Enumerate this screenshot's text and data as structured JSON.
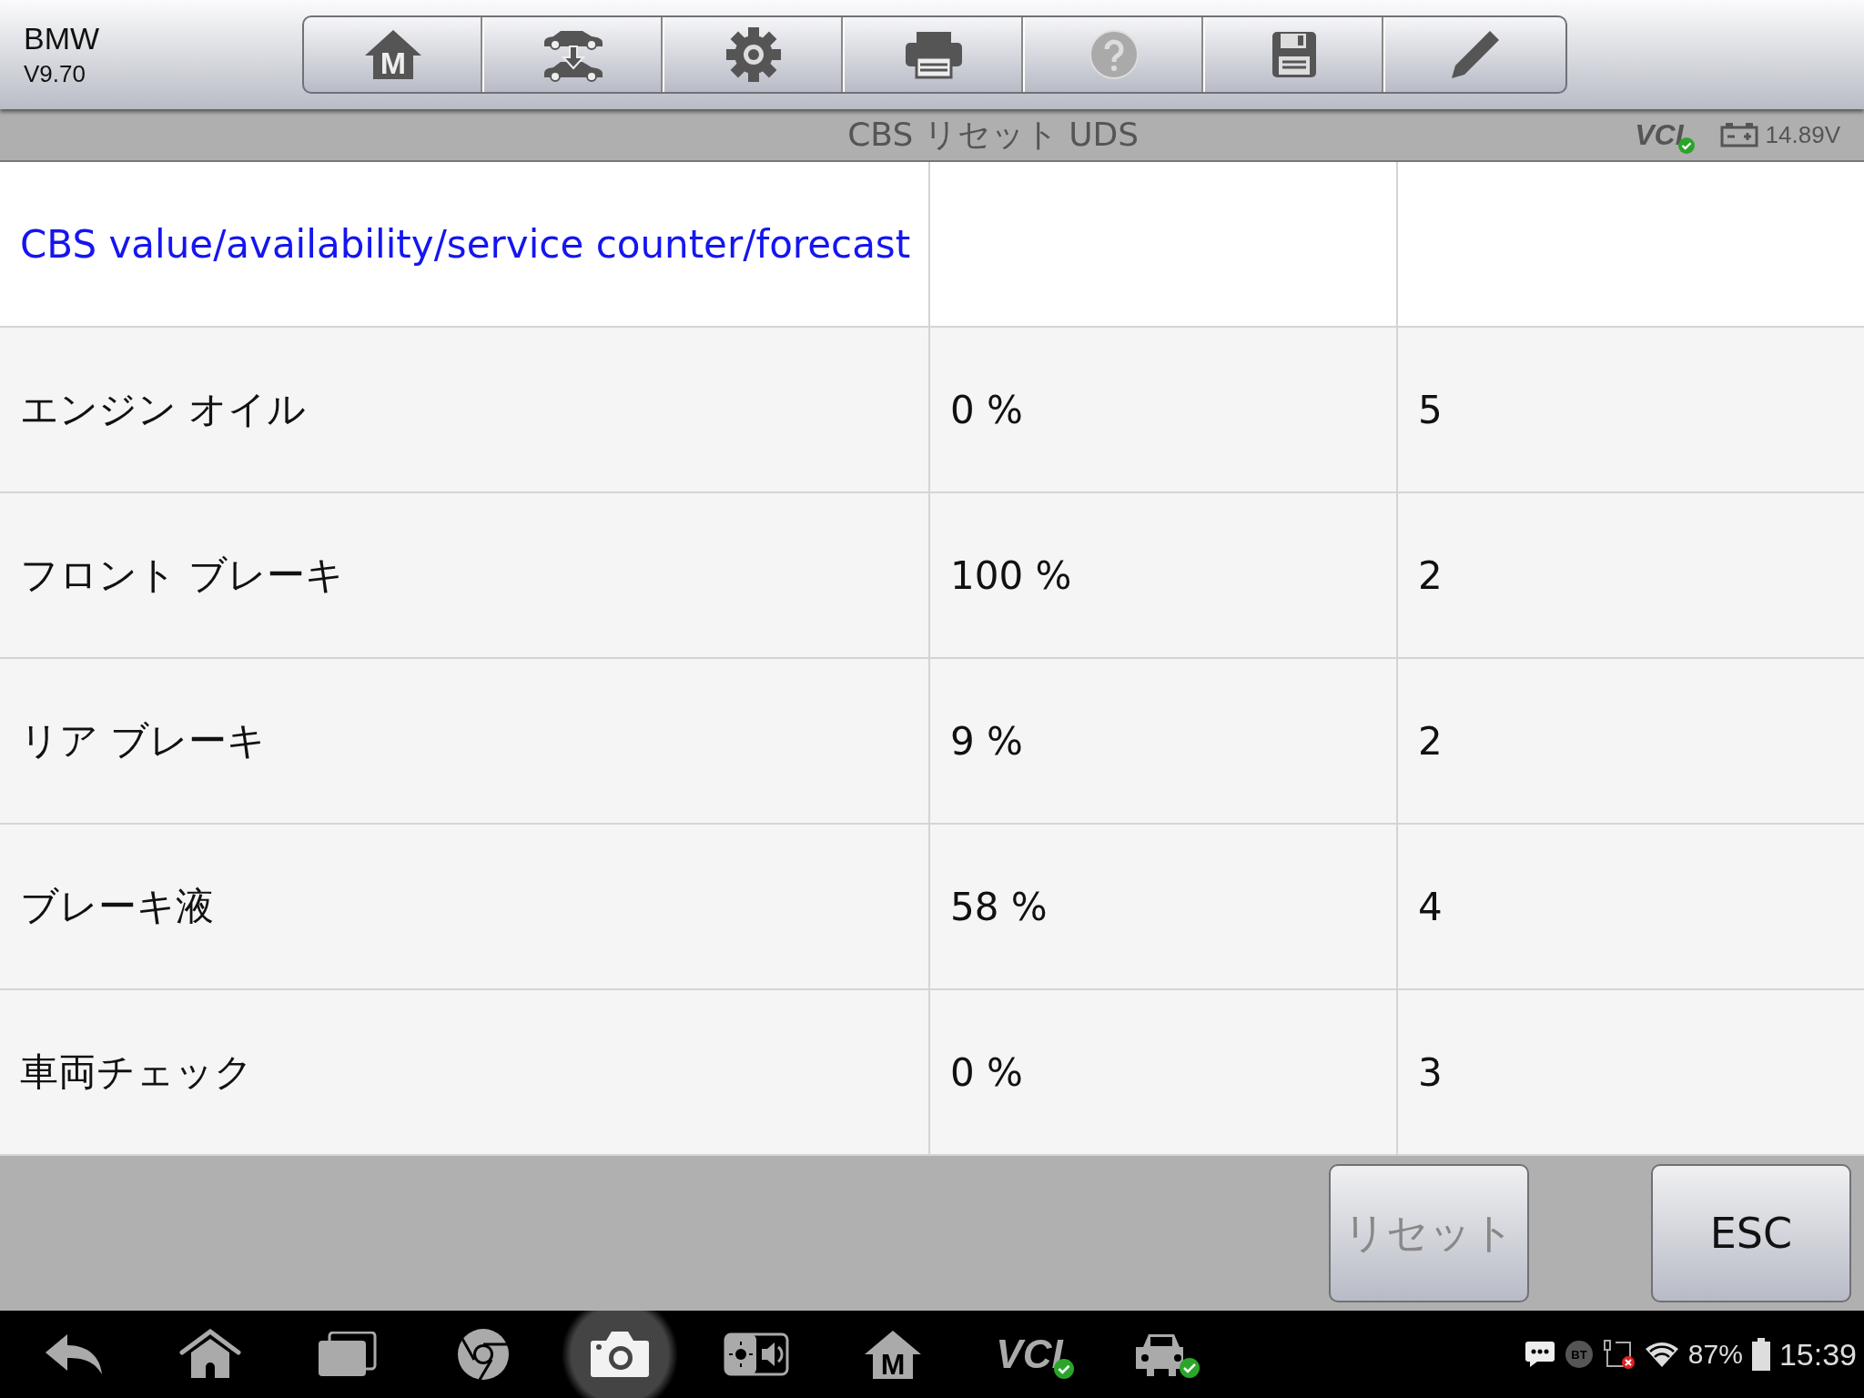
{
  "header": {
    "brand": "BMW",
    "version": "V9.70"
  },
  "toolbar": [
    {
      "kind": "home",
      "letter": "M",
      "disabled": false
    },
    {
      "kind": "vehicle-swap",
      "disabled": false
    },
    {
      "kind": "settings",
      "disabled": false
    },
    {
      "kind": "print",
      "disabled": false
    },
    {
      "kind": "help",
      "disabled": true
    },
    {
      "kind": "save",
      "disabled": false
    },
    {
      "kind": "edit",
      "disabled": false
    }
  ],
  "title_bar": {
    "title": "CBS リセット UDS",
    "vci": "VCI",
    "vci_connected": true,
    "voltage": "14.89V"
  },
  "table": {
    "header": "CBS value/availability/service counter/forecast",
    "rows": [
      {
        "name": "エンジン オイル",
        "value": "0 %",
        "count": "5"
      },
      {
        "name": "フロント ブレーキ",
        "value": "100 %",
        "count": "2"
      },
      {
        "name": "リア ブレーキ",
        "value": "9 %",
        "count": "2"
      },
      {
        "name": "ブレーキ液",
        "value": "58 %",
        "count": "4"
      },
      {
        "name": "車両チェック",
        "value": "0 %",
        "count": "3"
      }
    ]
  },
  "buttons": [
    {
      "label": "リセット",
      "disabled": true
    },
    {
      "label": "ESC",
      "disabled": false
    }
  ],
  "nav_bar": [
    {
      "kind": "back",
      "selected": false
    },
    {
      "kind": "home",
      "selected": false
    },
    {
      "kind": "recents",
      "selected": false
    },
    {
      "kind": "browser",
      "selected": false
    },
    {
      "kind": "camera",
      "selected": true
    },
    {
      "kind": "display-sound",
      "selected": false
    },
    {
      "kind": "m-home",
      "letter": "M",
      "selected": false
    },
    {
      "kind": "vci",
      "label": "VCI",
      "selected": false
    },
    {
      "kind": "car",
      "selected": false
    }
  ],
  "status": {
    "bt": "BT",
    "battery": "87%",
    "time": "15:39"
  }
}
